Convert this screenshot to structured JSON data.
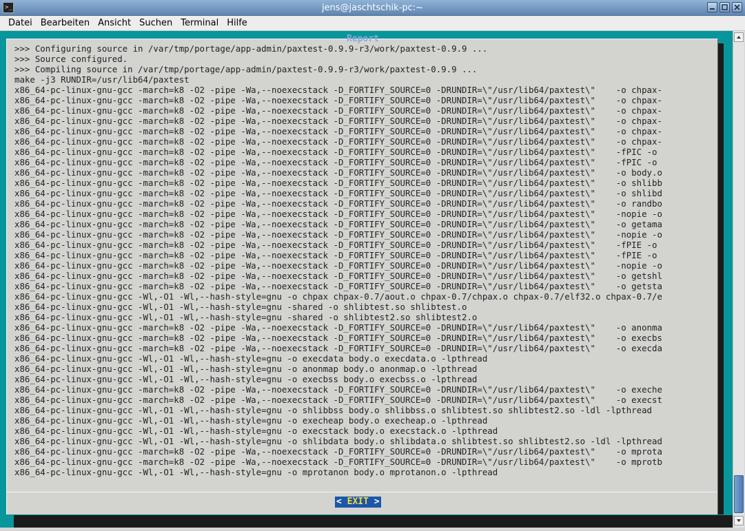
{
  "window": {
    "title": "jens@jaschtschik-pc:~",
    "app_icon_glyph": ">_"
  },
  "menubar": {
    "items": [
      "Datei",
      "Bearbeiten",
      "Ansicht",
      "Suchen",
      "Terminal",
      "Hilfe"
    ]
  },
  "dialog": {
    "title": "Report",
    "exit_left": "< ",
    "exit_label": "EXIT",
    "exit_right": " >",
    "lines": [
      ">>> Configuring source in /var/tmp/portage/app-admin/paxtest-0.9.9-r3/work/paxtest-0.9.9 ...",
      ">>> Source configured.",
      ">>> Compiling source in /var/tmp/portage/app-admin/paxtest-0.9.9-r3/work/paxtest-0.9.9 ...",
      "make -j3 RUNDIR=/usr/lib64/paxtest",
      "x86_64-pc-linux-gnu-gcc -march=k8 -O2 -pipe -Wa,--noexecstack -D_FORTIFY_SOURCE=0 -DRUNDIR=\\\"/usr/lib64/paxtest\\\"    -o chpax-",
      "x86_64-pc-linux-gnu-gcc -march=k8 -O2 -pipe -Wa,--noexecstack -D_FORTIFY_SOURCE=0 -DRUNDIR=\\\"/usr/lib64/paxtest\\\"    -o chpax-",
      "x86_64-pc-linux-gnu-gcc -march=k8 -O2 -pipe -Wa,--noexecstack -D_FORTIFY_SOURCE=0 -DRUNDIR=\\\"/usr/lib64/paxtest\\\"    -o chpax-",
      "x86_64-pc-linux-gnu-gcc -march=k8 -O2 -pipe -Wa,--noexecstack -D_FORTIFY_SOURCE=0 -DRUNDIR=\\\"/usr/lib64/paxtest\\\"    -o chpax-",
      "x86_64-pc-linux-gnu-gcc -march=k8 -O2 -pipe -Wa,--noexecstack -D_FORTIFY_SOURCE=0 -DRUNDIR=\\\"/usr/lib64/paxtest\\\"    -o chpax-",
      "x86_64-pc-linux-gnu-gcc -march=k8 -O2 -pipe -Wa,--noexecstack -D_FORTIFY_SOURCE=0 -DRUNDIR=\\\"/usr/lib64/paxtest\\\"    -o chpax-",
      "x86_64-pc-linux-gnu-gcc -march=k8 -O2 -pipe -Wa,--noexecstack -D_FORTIFY_SOURCE=0 -DRUNDIR=\\\"/usr/lib64/paxtest\\\"    -fPIC -o",
      "x86_64-pc-linux-gnu-gcc -march=k8 -O2 -pipe -Wa,--noexecstack -D_FORTIFY_SOURCE=0 -DRUNDIR=\\\"/usr/lib64/paxtest\\\"    -fPIC -o",
      "x86_64-pc-linux-gnu-gcc -march=k8 -O2 -pipe -Wa,--noexecstack -D_FORTIFY_SOURCE=0 -DRUNDIR=\\\"/usr/lib64/paxtest\\\"    -o body.o",
      "x86_64-pc-linux-gnu-gcc -march=k8 -O2 -pipe -Wa,--noexecstack -D_FORTIFY_SOURCE=0 -DRUNDIR=\\\"/usr/lib64/paxtest\\\"    -o shlibb",
      "x86_64-pc-linux-gnu-gcc -march=k8 -O2 -pipe -Wa,--noexecstack -D_FORTIFY_SOURCE=0 -DRUNDIR=\\\"/usr/lib64/paxtest\\\"    -o shlibd",
      "x86_64-pc-linux-gnu-gcc -march=k8 -O2 -pipe -Wa,--noexecstack -D_FORTIFY_SOURCE=0 -DRUNDIR=\\\"/usr/lib64/paxtest\\\"    -o randbo",
      "x86_64-pc-linux-gnu-gcc -march=k8 -O2 -pipe -Wa,--noexecstack -D_FORTIFY_SOURCE=0 -DRUNDIR=\\\"/usr/lib64/paxtest\\\"    -nopie -o",
      "x86_64-pc-linux-gnu-gcc -march=k8 -O2 -pipe -Wa,--noexecstack -D_FORTIFY_SOURCE=0 -DRUNDIR=\\\"/usr/lib64/paxtest\\\"    -o getama",
      "x86_64-pc-linux-gnu-gcc -march=k8 -O2 -pipe -Wa,--noexecstack -D_FORTIFY_SOURCE=0 -DRUNDIR=\\\"/usr/lib64/paxtest\\\"    -nopie -o",
      "x86_64-pc-linux-gnu-gcc -march=k8 -O2 -pipe -Wa,--noexecstack -D_FORTIFY_SOURCE=0 -DRUNDIR=\\\"/usr/lib64/paxtest\\\"    -fPIE -o",
      "x86_64-pc-linux-gnu-gcc -march=k8 -O2 -pipe -Wa,--noexecstack -D_FORTIFY_SOURCE=0 -DRUNDIR=\\\"/usr/lib64/paxtest\\\"    -fPIE -o",
      "x86_64-pc-linux-gnu-gcc -march=k8 -O2 -pipe -Wa,--noexecstack -D_FORTIFY_SOURCE=0 -DRUNDIR=\\\"/usr/lib64/paxtest\\\"    -nopie -o",
      "x86_64-pc-linux-gnu-gcc -march=k8 -O2 -pipe -Wa,--noexecstack -D_FORTIFY_SOURCE=0 -DRUNDIR=\\\"/usr/lib64/paxtest\\\"    -o getshl",
      "x86_64-pc-linux-gnu-gcc -march=k8 -O2 -pipe -Wa,--noexecstack -D_FORTIFY_SOURCE=0 -DRUNDIR=\\\"/usr/lib64/paxtest\\\"    -o getsta",
      "x86_64-pc-linux-gnu-gcc -Wl,-O1 -Wl,--hash-style=gnu -o chpax chpax-0.7/aout.o chpax-0.7/chpax.o chpax-0.7/elf32.o chpax-0.7/e",
      "x86_64-pc-linux-gnu-gcc -Wl,-O1 -Wl,--hash-style=gnu -shared -o shlibtest.so shlibtest.o",
      "x86_64-pc-linux-gnu-gcc -Wl,-O1 -Wl,--hash-style=gnu -shared -o shlibtest2.so shlibtest2.o",
      "x86_64-pc-linux-gnu-gcc -march=k8 -O2 -pipe -Wa,--noexecstack -D_FORTIFY_SOURCE=0 -DRUNDIR=\\\"/usr/lib64/paxtest\\\"    -o anonma",
      "x86_64-pc-linux-gnu-gcc -march=k8 -O2 -pipe -Wa,--noexecstack -D_FORTIFY_SOURCE=0 -DRUNDIR=\\\"/usr/lib64/paxtest\\\"    -o execbs",
      "x86_64-pc-linux-gnu-gcc -march=k8 -O2 -pipe -Wa,--noexecstack -D_FORTIFY_SOURCE=0 -DRUNDIR=\\\"/usr/lib64/paxtest\\\"    -o execda",
      "x86_64-pc-linux-gnu-gcc -Wl,-O1 -Wl,--hash-style=gnu -o execdata body.o execdata.o -lpthread",
      "x86_64-pc-linux-gnu-gcc -Wl,-O1 -Wl,--hash-style=gnu -o anonmap body.o anonmap.o -lpthread",
      "x86_64-pc-linux-gnu-gcc -Wl,-O1 -Wl,--hash-style=gnu -o execbss body.o execbss.o -lpthread",
      "x86_64-pc-linux-gnu-gcc -march=k8 -O2 -pipe -Wa,--noexecstack -D_FORTIFY_SOURCE=0 -DRUNDIR=\\\"/usr/lib64/paxtest\\\"    -o exeche",
      "x86_64-pc-linux-gnu-gcc -march=k8 -O2 -pipe -Wa,--noexecstack -D_FORTIFY_SOURCE=0 -DRUNDIR=\\\"/usr/lib64/paxtest\\\"    -o execst",
      "x86_64-pc-linux-gnu-gcc -Wl,-O1 -Wl,--hash-style=gnu -o shlibbss body.o shlibbss.o shlibtest.so shlibtest2.so -ldl -lpthread",
      "x86_64-pc-linux-gnu-gcc -Wl,-O1 -Wl,--hash-style=gnu -o execheap body.o execheap.o -lpthread",
      "x86_64-pc-linux-gnu-gcc -Wl,-O1 -Wl,--hash-style=gnu -o execstack body.o execstack.o -lpthread",
      "x86_64-pc-linux-gnu-gcc -Wl,-O1 -Wl,--hash-style=gnu -o shlibdata body.o shlibdata.o shlibtest.so shlibtest2.so -ldl -lpthread",
      "x86_64-pc-linux-gnu-gcc -march=k8 -O2 -pipe -Wa,--noexecstack -D_FORTIFY_SOURCE=0 -DRUNDIR=\\\"/usr/lib64/paxtest\\\"    -o mprota",
      "x86_64-pc-linux-gnu-gcc -march=k8 -O2 -pipe -Wa,--noexecstack -D_FORTIFY_SOURCE=0 -DRUNDIR=\\\"/usr/lib64/paxtest\\\"    -o mprotb",
      "x86_64-pc-linux-gnu-gcc -Wl,-O1 -Wl,--hash-style=gnu -o mprotanon body.o mprotanon.o -lpthread"
    ]
  },
  "icons": {
    "minimize": "minimize-icon",
    "maximize": "maximize-icon",
    "close": "close-icon",
    "scroll_up": "arrow-up-icon",
    "scroll_down": "arrow-down-icon"
  },
  "colors": {
    "terminal_bg": "#06969c",
    "dialog_bg": "#d3d3d0",
    "title_accent": "#8aa9d8",
    "exit_bg": "#1b56a8",
    "exit_fg": "#f5d83a"
  }
}
